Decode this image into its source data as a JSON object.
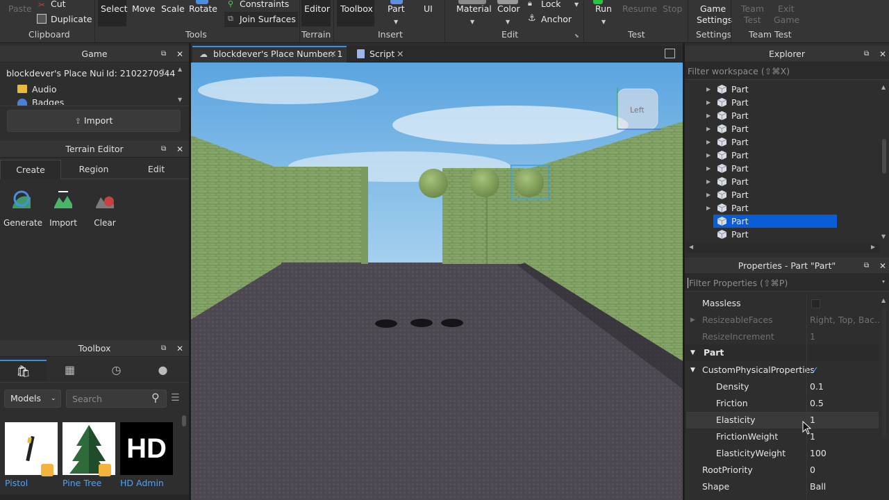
{
  "ribbon": {
    "clipboard": {
      "paste": "Paste",
      "cut": "Cut",
      "duplicate": "Duplicate",
      "group": "Clipboard"
    },
    "tools": {
      "select": "Select",
      "move": "Move",
      "scale": "Scale",
      "rotate": "Rotate",
      "constraints": "Constraints",
      "join_surfaces": "Join Surfaces",
      "group": "Tools"
    },
    "terrain": {
      "editor": "Editor",
      "group": "Terrain"
    },
    "insert": {
      "toolbox": "Toolbox",
      "part": "Part",
      "ui": "UI",
      "group": "Insert"
    },
    "edit": {
      "material": "Material",
      "color": "Color",
      "lock": "Lock",
      "anchor": "Anchor",
      "group": "Edit"
    },
    "test": {
      "run": "Run",
      "resume": "Resume",
      "stop": "Stop",
      "group": "Test"
    },
    "settings": {
      "game_settings_1": "Game",
      "game_settings_2": "Settings",
      "group": "Settings"
    },
    "team_test": {
      "team_test_1": "Team",
      "team_test_2": "Test",
      "exit_game_1": "Exit",
      "exit_game_2": "Game",
      "group": "Team Test"
    }
  },
  "game_panel": {
    "title": "Game",
    "place_name": "blockdever's Place Nui",
    "place_id": "Id: 2102270944",
    "items": [
      "Audio",
      "Badges"
    ],
    "import_label": "Import"
  },
  "terrain_editor": {
    "title": "Terrain Editor",
    "tabs": [
      "Create",
      "Region",
      "Edit"
    ],
    "tools": [
      "Generate",
      "Import",
      "Clear"
    ]
  },
  "toolbox": {
    "title": "Toolbox",
    "category": "Models",
    "search_placeholder": "Search",
    "items": [
      {
        "name": "Pistol"
      },
      {
        "name": "Pine Tree"
      },
      {
        "name": "HD Admin",
        "thumb_text": "HD"
      }
    ]
  },
  "doc_tabs": {
    "place_tab": "blockdever's Place Number: 1",
    "script_tab": "Script"
  },
  "viewport": {
    "view_cube_label": "Left"
  },
  "explorer": {
    "title": "Explorer",
    "filter_placeholder": "Filter workspace (⇧⌘X)",
    "items": [
      "Part",
      "Part",
      "Part",
      "Part",
      "Part",
      "Part",
      "Part",
      "Part",
      "Part",
      "Part",
      "Part",
      "Part"
    ],
    "selected_index": 10
  },
  "properties": {
    "title": "Properties - Part \"Part\"",
    "filter_placeholder": "Filter Properties (⇧⌘P)",
    "rows": [
      {
        "name": "Massless",
        "value": ""
      },
      {
        "name": "ResizeableFaces",
        "value": "Right, Top, Bac..."
      },
      {
        "name": "ResizeIncrement",
        "value": "1"
      },
      {
        "name": "Part",
        "value": ""
      },
      {
        "name": "CustomPhysicalProperties",
        "value": "✓"
      },
      {
        "name": "Density",
        "value": "0.1"
      },
      {
        "name": "Friction",
        "value": "0.5"
      },
      {
        "name": "Elasticity",
        "value": "1"
      },
      {
        "name": "FrictionWeight",
        "value": "1"
      },
      {
        "name": "ElasticityWeight",
        "value": "100"
      },
      {
        "name": "RootPriority",
        "value": "0"
      },
      {
        "name": "Shape",
        "value": "Ball"
      }
    ]
  },
  "colors": {
    "accent": "#0b5cd7",
    "link": "#4aa3ff",
    "panel_bg": "#2e2e2e"
  }
}
